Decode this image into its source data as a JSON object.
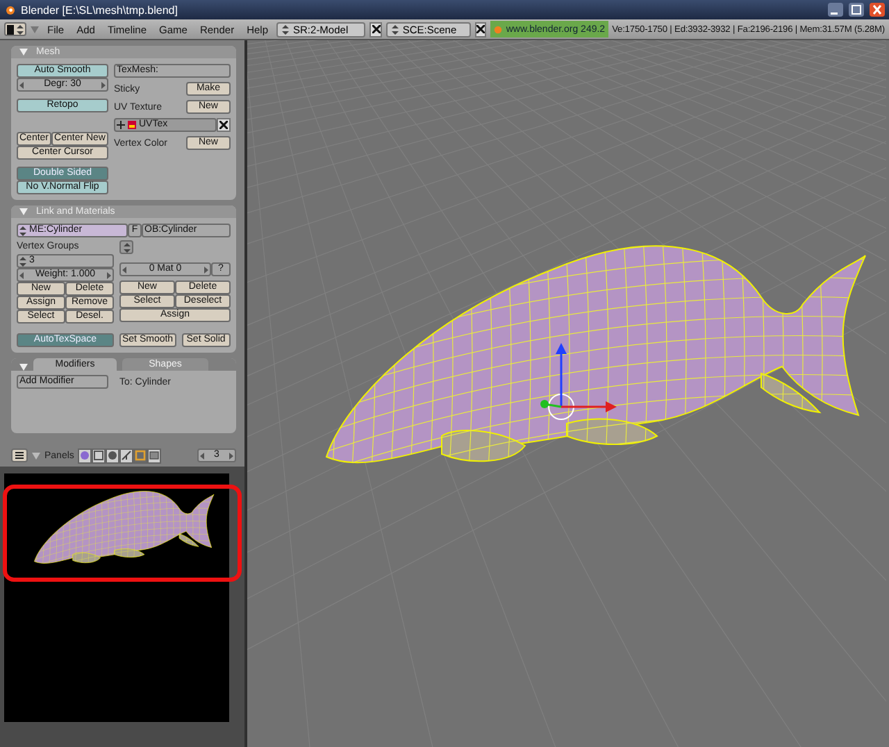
{
  "window": {
    "title": "Blender [E:\\SL\\mesh\\tmp.blend]"
  },
  "header": {
    "menus": [
      "File",
      "Add",
      "Timeline",
      "Game",
      "Render",
      "Help"
    ],
    "screen": "SR:2-Model",
    "scene": "SCE:Scene",
    "version": "www.blender.org 249.2",
    "stats": "Ve:1750-1750 | Ed:3932-3932 | Fa:2196-2196 | Mem:31.57M (5.28M)"
  },
  "mesh_panel": {
    "title": "Mesh",
    "auto_smooth": {
      "label": "Auto Smooth",
      "on": false
    },
    "degree": "Degr: 30",
    "retopo": {
      "label": "Retopo",
      "on": false
    },
    "center_buttons": [
      "Center",
      "Center New"
    ],
    "center_cursor": "Center Cursor",
    "double_sided": {
      "label": "Double Sided",
      "on": true
    },
    "normal_flip": {
      "label": "No V.Normal Flip",
      "on": false
    },
    "texmesh": "TexMesh:",
    "rows": [
      {
        "label": "Sticky",
        "button": "Make"
      },
      {
        "label": "UV Texture",
        "button": "New"
      },
      {
        "label": "Vertex Color",
        "button": "New"
      }
    ],
    "uv_layer": "UVTex"
  },
  "link_panel": {
    "title": "Link and Materials",
    "mesh": "ME:Cylinder",
    "fake": "F",
    "object": "OB:Cylinder",
    "vertex_groups": {
      "label": "Vertex Groups",
      "group": "3",
      "weight": "Weight: 1.000",
      "buttons": [
        "New",
        "Delete",
        "Assign",
        "Remove",
        "Select",
        "Desel."
      ]
    },
    "material": {
      "field": "0 Mat 0",
      "help": "?",
      "buttons": [
        "New",
        "Delete",
        "Select",
        "Deselect"
      ],
      "assign": "Assign"
    },
    "auto_tex_space": {
      "label": "AutoTexSpace",
      "on": true
    },
    "set_smooth": "Set Smooth",
    "set_solid": "Set Solid"
  },
  "modifiers_panel": {
    "tabs": [
      {
        "label": "Modifiers",
        "selected": true
      },
      {
        "label": "Shapes",
        "selected": false
      }
    ],
    "add_button": "Add Modifier",
    "target": "To: Cylinder"
  },
  "panels_bar": {
    "label": "Panels",
    "contexts": [
      {
        "kind": "logic",
        "selected": false
      },
      {
        "kind": "script",
        "selected": false
      },
      {
        "kind": "shading",
        "selected": false
      },
      {
        "kind": "object",
        "selected": false
      },
      {
        "kind": "editing",
        "selected": true
      },
      {
        "kind": "scene",
        "selected": false
      }
    ],
    "page": "3"
  }
}
